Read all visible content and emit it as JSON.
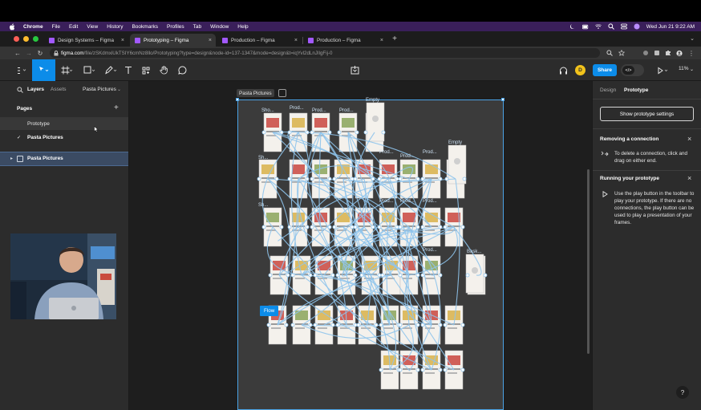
{
  "menubar": {
    "app": "Chrome",
    "items": [
      "File",
      "Edit",
      "View",
      "History",
      "Bookmarks",
      "Profiles",
      "Tab",
      "Window",
      "Help"
    ],
    "clock": "Wed Jun 21  9:22 AM"
  },
  "tabs": [
    {
      "label": "Design Systems – Figma",
      "active": false
    },
    {
      "label": "Prototyping – Figma",
      "active": true
    },
    {
      "label": "Production – Figma",
      "active": false
    },
    {
      "label": "Production – Figma",
      "active": false
    }
  ],
  "address": {
    "host": "figma.com",
    "path": "/file/zSKdmxiUkTSIY6cmNz8llo/Prototyping?type=design&node-id=137-1347&mode=design&t=iqYvl2dLnJIlgFij-0"
  },
  "toolbar": {
    "avatar_initial": "D",
    "share_label": "Share",
    "zoom": "11%"
  },
  "left_panel": {
    "tab_layers": "Layers",
    "tab_assets": "Assets",
    "page_selector": "Pasta Pictures",
    "pages_heading": "Pages",
    "pages": [
      {
        "name": "Prototype",
        "current": false
      },
      {
        "name": "Pasta Pictures",
        "current": true
      }
    ],
    "layer": "Pasta Pictures"
  },
  "canvas": {
    "frame_label": "Pasta Pictures",
    "flow_label": "Flow",
    "frame_titles": [
      {
        "text": "Sho..."
      },
      {
        "text": "Prod..."
      },
      {
        "text": "Prod..."
      },
      {
        "text": "Prod..."
      },
      {
        "text": "Empty"
      },
      {
        "text": "Empty"
      },
      {
        "text": "Prod..."
      },
      {
        "text": "Prod..."
      },
      {
        "text": "Prod..."
      },
      {
        "text": "Sh..."
      },
      {
        "text": "Sh..."
      },
      {
        "text": "Prod..."
      },
      {
        "text": "Prod..."
      },
      {
        "text": "Prod..."
      },
      {
        "text": "Bask..."
      },
      {
        "text": "Prod..."
      }
    ]
  },
  "right_panel": {
    "tab_design": "Design",
    "tab_prototype": "Prototype",
    "settings_button": "Show prototype settings",
    "section1_title": "Removing a connection",
    "section1_text": "To delete a connection, click and drag on either end.",
    "section2_title": "Running your prototype",
    "section2_text": "Use the play button in the toolbar to play your prototype. If there are no connections, the play button can be used to play a presentation of your frames.",
    "help": "?"
  },
  "colors": {
    "accent": "#0c8ce9",
    "connector": "#8fc4ec",
    "menubar": "#3a1f5a",
    "panel": "#2c2c2c",
    "canvas": "#1e1e1e"
  }
}
